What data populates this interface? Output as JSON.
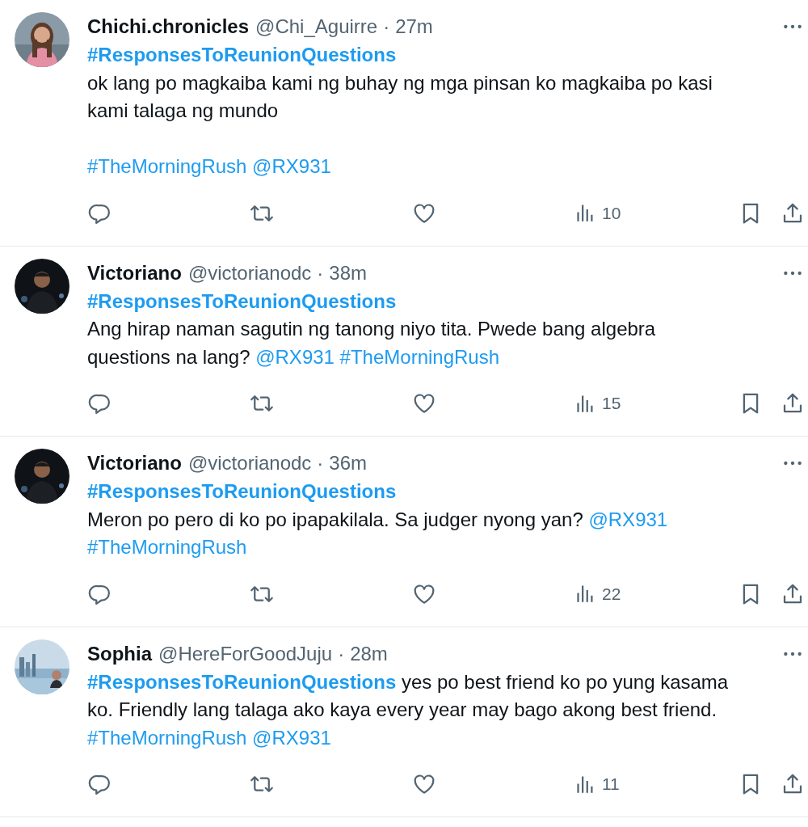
{
  "tweets": [
    {
      "name": "Chichi.chronicles",
      "handle": "@Chi_Aguirre",
      "separator": "·",
      "time": "27m",
      "body": [
        {
          "kind": "hashtag_bold",
          "text": "#ResponsesToReunionQuestions"
        },
        {
          "kind": "break"
        },
        {
          "kind": "text",
          "text": "ok lang po magkaiba kami ng buhay ng mga pinsan ko magkaiba po kasi"
        },
        {
          "kind": "break"
        },
        {
          "kind": "text",
          "text": "kami talaga ng mundo"
        },
        {
          "kind": "break"
        },
        {
          "kind": "break"
        },
        {
          "kind": "hashtag",
          "text": "#TheMorningRush"
        },
        {
          "kind": "space"
        },
        {
          "kind": "mention",
          "text": "@RX931"
        }
      ],
      "views": "10"
    },
    {
      "name": "Victoriano",
      "handle": "@victorianodc",
      "separator": "·",
      "time": "38m",
      "body": [
        {
          "kind": "hashtag_bold",
          "text": "#ResponsesToReunionQuestions"
        },
        {
          "kind": "break"
        },
        {
          "kind": "text",
          "text": "Ang hirap naman sagutin ng tanong niyo tita. Pwede bang algebra"
        },
        {
          "kind": "break"
        },
        {
          "kind": "text",
          "text": "questions na lang? "
        },
        {
          "kind": "mention",
          "text": "@RX931"
        },
        {
          "kind": "space"
        },
        {
          "kind": "hashtag",
          "text": "#TheMorningRush"
        }
      ],
      "views": "15"
    },
    {
      "name": "Victoriano",
      "handle": "@victorianodc",
      "separator": "·",
      "time": "36m",
      "body": [
        {
          "kind": "hashtag_bold",
          "text": "#ResponsesToReunionQuestions"
        },
        {
          "kind": "break"
        },
        {
          "kind": "text",
          "text": "Meron po pero di ko po ipapakilala. Sa judger nyong yan? "
        },
        {
          "kind": "mention",
          "text": "@RX931"
        },
        {
          "kind": "break"
        },
        {
          "kind": "hashtag",
          "text": "#TheMorningRush"
        }
      ],
      "views": "22"
    },
    {
      "name": "Sophia",
      "handle": "@HereForGoodJuju",
      "separator": "·",
      "time": "28m",
      "body": [
        {
          "kind": "hashtag_bold",
          "text": "#ResponsesToReunionQuestions"
        },
        {
          "kind": "text",
          "text": " yes po best friend ko po yung kasama"
        },
        {
          "kind": "break"
        },
        {
          "kind": "text",
          "text": "ko. Friendly lang talaga ako kaya every year may bago akong best friend."
        },
        {
          "kind": "break"
        },
        {
          "kind": "hashtag",
          "text": "#TheMorningRush"
        },
        {
          "kind": "space"
        },
        {
          "kind": "mention",
          "text": "@RX931"
        }
      ],
      "views": "11"
    }
  ]
}
